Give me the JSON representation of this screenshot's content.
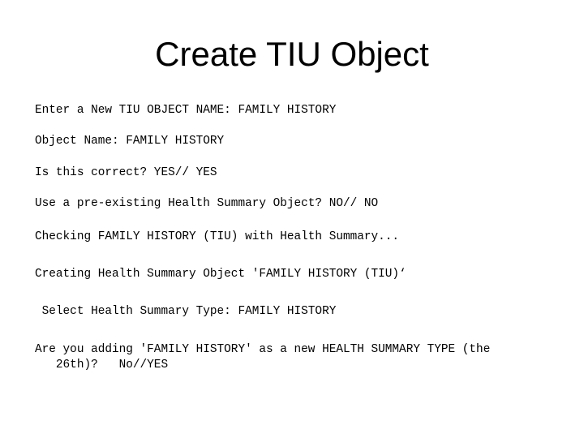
{
  "slide": {
    "title": "Create TIU Object",
    "lines": [
      "Enter a New TIU OBJECT NAME: FAMILY HISTORY",
      "Object Name: FAMILY HISTORY",
      "Is this correct? YES// YES",
      "Use a pre-existing Health Summary Object? NO// NO",
      "Checking FAMILY HISTORY (TIU) with Health Summary...",
      "Creating Health Summary Object 'FAMILY HISTORY (TIU)‘",
      " Select Health Summary Type: FAMILY HISTORY",
      "Are you adding 'FAMILY HISTORY' as a new HEALTH SUMMARY TYPE (the",
      "   26th)?   No//YES"
    ]
  }
}
